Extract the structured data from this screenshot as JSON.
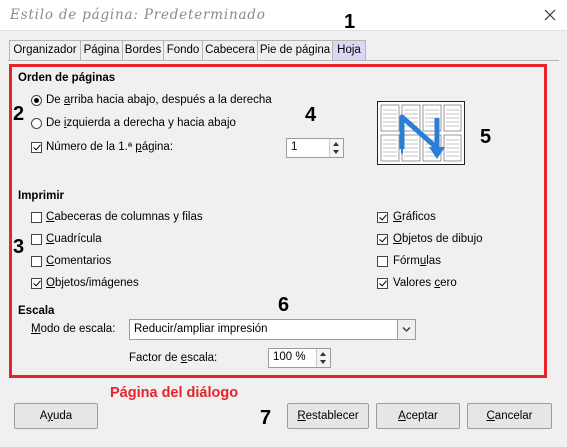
{
  "window": {
    "title": "Estilo de página: Predeterminado"
  },
  "tabs": [
    {
      "label": "Organizador",
      "active": false
    },
    {
      "label": "Página",
      "active": false
    },
    {
      "label": "Bordes",
      "active": false
    },
    {
      "label": "Fondo",
      "active": false
    },
    {
      "label": "Cabecera",
      "active": false
    },
    {
      "label": "Pie de página",
      "active": false
    },
    {
      "label": "Hoja",
      "active": true
    }
  ],
  "callouts": [
    "1",
    "2",
    "3",
    "4",
    "5",
    "6",
    "7"
  ],
  "page_order": {
    "heading": "Orden de páginas",
    "options": [
      {
        "pre": "De ",
        "key": "a",
        "post": "rriba hacia abajo, después a la derecha",
        "selected": true
      },
      {
        "pre": "De ",
        "key": "i",
        "post": "zquierda a derecha y hacia abajo",
        "selected": false
      }
    ],
    "first_page": {
      "pre": "Número de la 1.ª ",
      "key": "p",
      "post": "ágina:",
      "checked": true,
      "value": "1"
    }
  },
  "print": {
    "heading": "Imprimir",
    "left": [
      {
        "pre": "",
        "key": "C",
        "post": "abeceras de columnas y filas",
        "checked": false
      },
      {
        "pre": "",
        "key": "C",
        "post": "uadrícula",
        "checked": false
      },
      {
        "pre": "",
        "key": "C",
        "post": "omentarios",
        "checked": false
      },
      {
        "pre": "",
        "key": "O",
        "post": "bjetos/imágenes",
        "checked": true
      }
    ],
    "right": [
      {
        "pre": "",
        "key": "G",
        "post": "ráficos",
        "checked": true
      },
      {
        "pre": "",
        "key": "O",
        "post": "bjetos de dibujo",
        "checked": true
      },
      {
        "pre": "Fórm",
        "key": "u",
        "post": "las",
        "checked": false
      },
      {
        "pre": "Valores ",
        "key": "c",
        "post": "ero",
        "checked": true
      }
    ]
  },
  "scale": {
    "heading": "Escala",
    "mode_label_key": "M",
    "mode_label_rest": "odo de escala:",
    "mode_value": "Reducir/ampliar impresión",
    "factor_label_pre": "Factor de ",
    "factor_label_key": "e",
    "factor_label_post": "scala:",
    "factor_value": "100 %"
  },
  "caption": "Página del diálogo",
  "buttons": {
    "help": {
      "pre": "A",
      "key": "y",
      "post": "uda"
    },
    "reset": {
      "pre": "",
      "key": "R",
      "post": "establecer"
    },
    "ok": {
      "pre": "",
      "key": "A",
      "post": "ceptar"
    },
    "cancel": {
      "pre": "",
      "key": "C",
      "post": "ancelar"
    }
  },
  "colors": {
    "highlight_red": "#e8232a",
    "active_tab": "#dcd6f4",
    "preview_arrow": "#2a7fd4"
  },
  "icons": [
    "close-icon",
    "page-order-preview-icon",
    "chevron-down-icon"
  ]
}
